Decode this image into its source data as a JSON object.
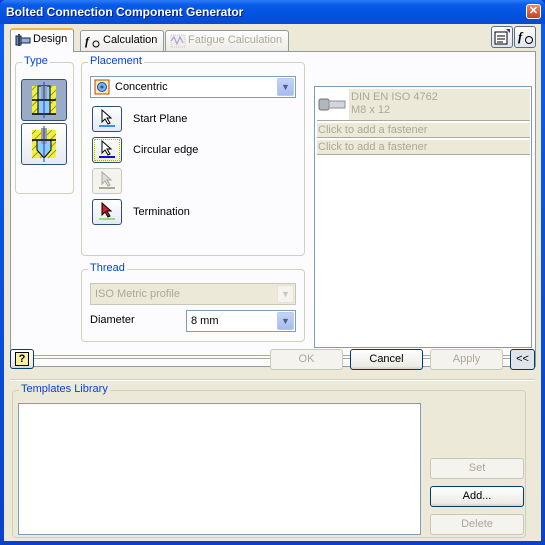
{
  "window": {
    "title": "Bolted Connection Component Generator",
    "close_label": "✕"
  },
  "tabs": [
    {
      "label": "Design",
      "icon": "design-icon",
      "state": "active"
    },
    {
      "label": "Calculation",
      "icon": "fx-icon",
      "state": "normal"
    },
    {
      "label": "Fatigue Calculation",
      "icon": "fatigue-icon",
      "state": "disabled"
    }
  ],
  "toolbar": {
    "properties_icon": "properties-icon",
    "fx_icon": "fx-icon"
  },
  "type_group": {
    "label": "Type",
    "options": [
      {
        "name": "through-bolt",
        "selected": true
      },
      {
        "name": "blind-bolt",
        "selected": false
      }
    ]
  },
  "placement": {
    "label": "Placement",
    "mode": "Concentric",
    "selectors": [
      {
        "label": "Start Plane",
        "bar_color": "#3a8ef0",
        "enabled": true
      },
      {
        "label": "Circular edge",
        "bar_color": "#1010c8",
        "enabled": true
      },
      {
        "label": "",
        "bar_color": "#aca899",
        "enabled": false
      },
      {
        "label": "Termination",
        "bar_color": "#8ee07a",
        "enabled": true
      }
    ]
  },
  "thread": {
    "label": "Thread",
    "profile": "ISO Metric profile",
    "diameter_label": "Diameter",
    "diameter": "8 mm"
  },
  "fasteners": {
    "items": [
      {
        "line1": "DIN EN ISO 4762",
        "line2": "M8 x 12"
      },
      {
        "line1": "Click to add a fastener"
      },
      {
        "line1": "Click to add a fastener"
      }
    ]
  },
  "expand": {
    "left": "»",
    "right": "»"
  },
  "buttons": {
    "help": "?",
    "ok": "OK",
    "cancel": "Cancel",
    "apply": "Apply",
    "collapse": "<<"
  },
  "templates": {
    "label": "Templates Library",
    "set": "Set",
    "add": "Add...",
    "delete": "Delete"
  }
}
